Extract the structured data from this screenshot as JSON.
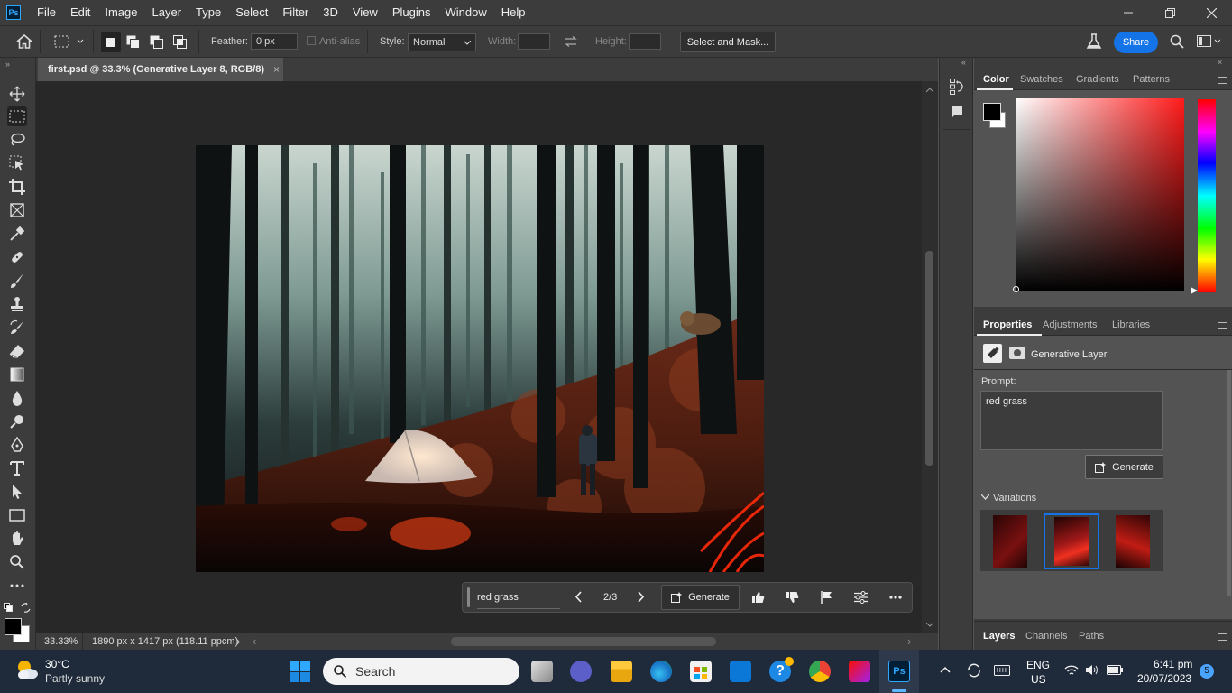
{
  "app": {
    "logo_text": "Ps"
  },
  "menu": [
    "File",
    "Edit",
    "Image",
    "Layer",
    "Type",
    "Select",
    "Filter",
    "3D",
    "View",
    "Plugins",
    "Window",
    "Help"
  ],
  "options": {
    "feather_label": "Feather:",
    "feather_value": "0 px",
    "antialias_label": "Anti-alias",
    "style_label": "Style:",
    "style_value": "Normal",
    "width_label": "Width:",
    "height_label": "Height:",
    "select_mask_label": "Select and Mask...",
    "share_label": "Share"
  },
  "document": {
    "tab_title": "first.psd @ 33.3% (Generative Layer 8, RGB/8)"
  },
  "context_bar": {
    "prompt": "red grass",
    "counter": "2/3",
    "generate_label": "Generate"
  },
  "status": {
    "zoom": "33.33%",
    "dimensions": "1890 px x 1417 px (118.11 ppcm)"
  },
  "color_panel": {
    "tabs": [
      "Color",
      "Swatches",
      "Gradients",
      "Patterns"
    ],
    "hue_color": "#ff1a1a"
  },
  "properties_panel": {
    "tabs": [
      "Properties",
      "Adjustments",
      "Libraries"
    ],
    "layer_type": "Generative Layer",
    "prompt_label": "Prompt:",
    "prompt_value": "red grass",
    "generate_label": "Generate",
    "variations_label": "Variations"
  },
  "layers_panel": {
    "tabs": [
      "Layers",
      "Channels",
      "Paths"
    ]
  },
  "taskbar": {
    "weather_temp": "30°C",
    "weather_desc": "Partly sunny",
    "search_placeholder": "Search",
    "lang1": "ENG",
    "lang2": "US",
    "time": "6:41 pm",
    "date": "20/07/2023",
    "notification_count": "5"
  }
}
